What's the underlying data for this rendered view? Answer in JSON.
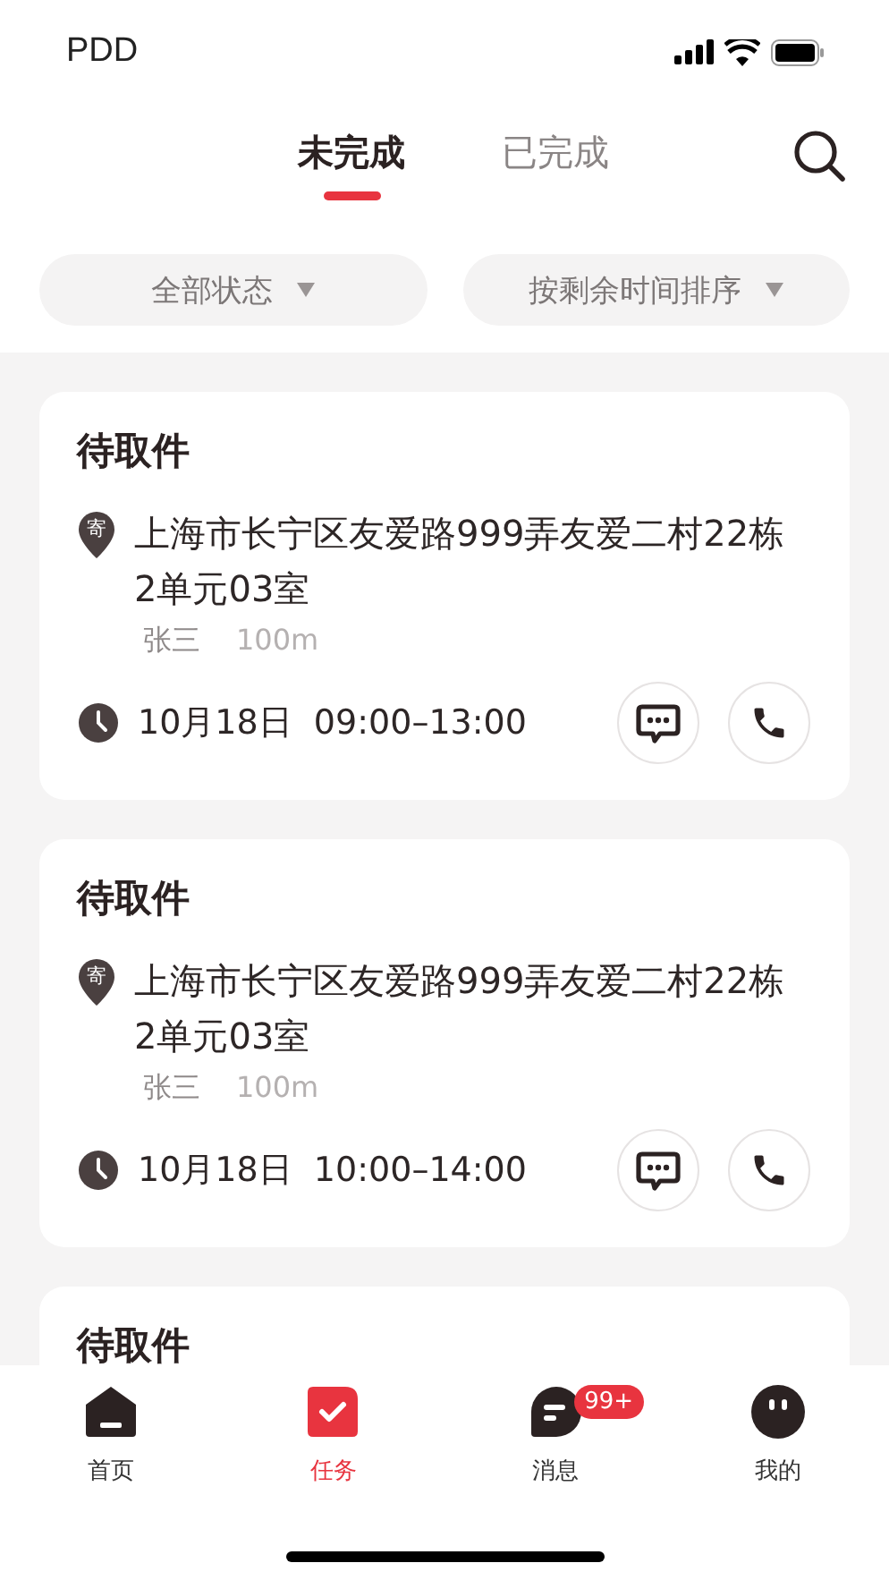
{
  "status_bar": {
    "carrier": "PDD"
  },
  "tabs": [
    {
      "label": "未完成",
      "selected": true
    },
    {
      "label": "已完成",
      "selected": false
    }
  ],
  "filters": [
    {
      "label": "全部状态"
    },
    {
      "label": "按剩余时间排序"
    }
  ],
  "cards": [
    {
      "title": "待取件",
      "pin_label": "寄",
      "address": "上海市长宁区友爱路999弄友爱二村22栋2单元03室",
      "name": "张三",
      "distance": "100m",
      "time": "10月18日  09:00–13:00"
    },
    {
      "title": "待取件",
      "pin_label": "寄",
      "address": "上海市长宁区友爱路999弄友爱二村22栋2单元03室",
      "name": "张三",
      "distance": "100m",
      "time": "10月18日  10:00–14:00"
    },
    {
      "title": "待取件"
    }
  ],
  "nav": [
    {
      "label": "首页",
      "selected": false
    },
    {
      "label": "任务",
      "selected": true
    },
    {
      "label": "消息",
      "selected": false,
      "badge": "99+"
    },
    {
      "label": "我的",
      "selected": false
    }
  ]
}
